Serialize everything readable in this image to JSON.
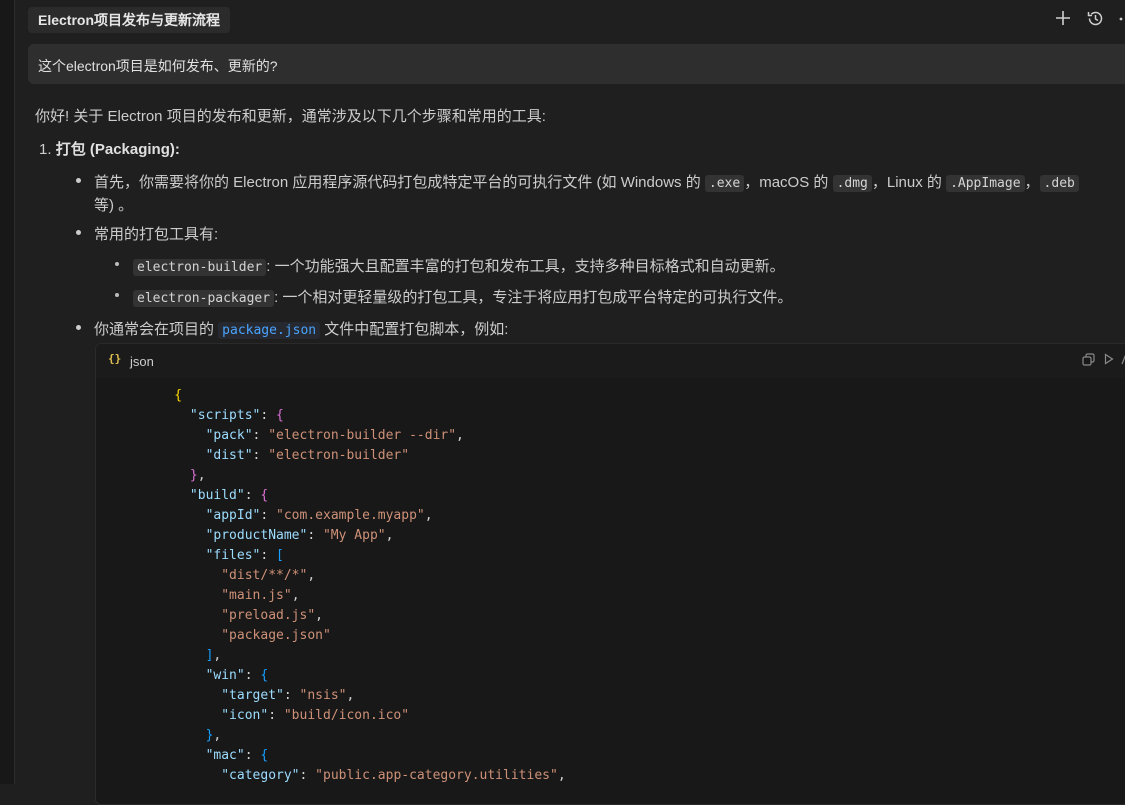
{
  "header": {
    "title": "Electron项目发布与更新流程",
    "new_icon": "plus-icon",
    "history_icon": "history-icon",
    "more_icon": "more-icon"
  },
  "user_message": "这个electron项目是如何发布、更新的?",
  "answer": {
    "intro": "你好! 关于 Electron 项目的发布和更新，通常涉及以下几个步骤和常用的工具:",
    "section1": {
      "number": "1.",
      "title": "打包 (Packaging):",
      "bullet1": {
        "t1": "首先，你需要将你的 Electron 应用程序源代码打包成特定平台的可执行文件 (如 Windows 的 ",
        "c1": ".exe",
        "t2": "，macOS 的 ",
        "c2": ".dmg",
        "t3": "，Linux 的 ",
        "c3": ".AppImage",
        "t4": "，",
        "c4": ".deb",
        "cont": "等) 。"
      },
      "bullet2": "常用的打包工具有:",
      "sub1": {
        "code": "electron-builder",
        "text": ": 一个功能强大且配置丰富的打包和发布工具，支持多种目标格式和自动更新。"
      },
      "sub2": {
        "code": "electron-packager",
        "text": ": 一个相对更轻量级的打包工具，专注于将应用打包成平台特定的可执行文件。"
      },
      "bullet3": {
        "t1": "你通常会在项目的 ",
        "code": "package.json",
        "t2": " 文件中配置打包脚本，例如:"
      }
    }
  },
  "code_block": {
    "language": "json",
    "lang_icon": "{}",
    "copy_icon": "copy-icon",
    "run_icon": "run-icon",
    "scripts_key": "\"scripts\"",
    "pack_key": "\"pack\"",
    "pack_val": "\"electron-builder --dir\"",
    "dist_key": "\"dist\"",
    "dist_val": "\"electron-builder\"",
    "build_key": "\"build\"",
    "appid_key": "\"appId\"",
    "appid_val": "\"com.example.myapp\"",
    "product_key": "\"productName\"",
    "product_val": "\"My App\"",
    "files_key": "\"files\"",
    "files": [
      "\"dist/**/*\"",
      "\"main.js\"",
      "\"preload.js\"",
      "\"package.json\""
    ],
    "win_key": "\"win\"",
    "target_key": "\"target\"",
    "target_val": "\"nsis\"",
    "icon_key": "\"icon\"",
    "icon_val": "\"build/icon.ico\"",
    "mac_key": "\"mac\"",
    "category_key": "\"category\"",
    "category_val": "\"public.app-category.utilities\""
  }
}
